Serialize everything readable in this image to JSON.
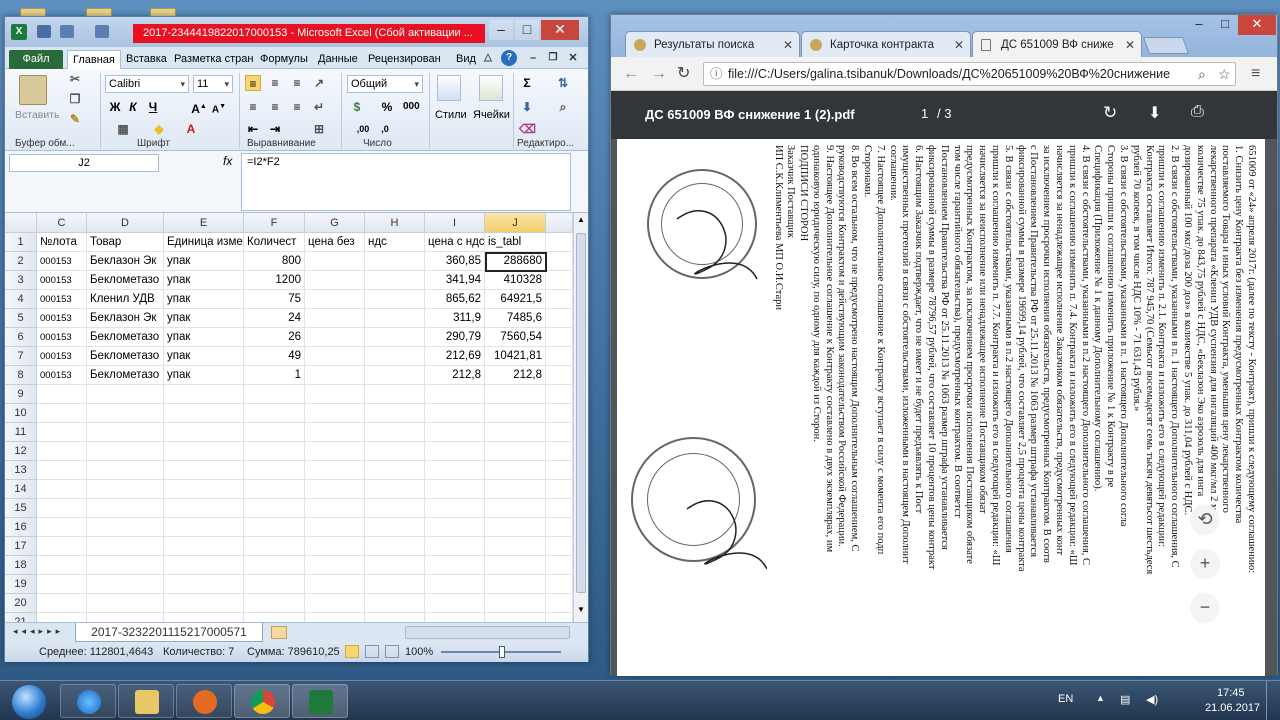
{
  "excel": {
    "title": "2017-2344419822017000153  -  Microsoft Excel (Сбой активации ...",
    "ribbon_tabs": [
      "Файл",
      "Главная",
      "Вставка",
      "Разметка стран",
      "Формулы",
      "Данные",
      "Рецензирован",
      "Вид"
    ],
    "ribbon": {
      "paste": "Вставить",
      "clipboard": "Буфер обм...",
      "font_name": "Calibri",
      "font_size": "11",
      "font_group": "Шрифт",
      "align_group": "Выравнивание",
      "number_format": "Общий",
      "number_group": "Число",
      "styles": "Стили",
      "cells": "Ячейки",
      "editing": "Редактиро..."
    },
    "name_box": "J2",
    "fx": "fx",
    "formula": "=I2*F2",
    "columns": [
      "C",
      "D",
      "E",
      "F",
      "G",
      "H",
      "I",
      "J"
    ],
    "header_row": [
      "№лота",
      "Товар",
      "Единица изме",
      "Количест",
      "цена без",
      "ндс",
      "цена с ндс",
      "is_tabl"
    ],
    "rows": [
      [
        "000153",
        "Беклазон Эк",
        "упак",
        "800",
        "",
        "",
        "360,85",
        "288680"
      ],
      [
        "000153",
        "Беклометазо",
        "упак",
        "1200",
        "",
        "",
        "341,94",
        "410328"
      ],
      [
        "000153",
        "Кленил УДВ",
        "упак",
        "75",
        "",
        "",
        "865,62",
        "64921,5"
      ],
      [
        "000153",
        "Беклазон Эк",
        "упак",
        "24",
        "",
        "",
        "311,9",
        "7485,6"
      ],
      [
        "000153",
        "Беклометазо",
        "упак",
        "26",
        "",
        "",
        "290,79",
        "7560,54"
      ],
      [
        "000153",
        "Беклометазо",
        "упак",
        "49",
        "",
        "",
        "212,69",
        "10421,81"
      ],
      [
        "000153",
        "Беклометазо",
        "упак",
        "1",
        "",
        "",
        "212,8",
        "212,8"
      ]
    ],
    "row_numbers": [
      "1",
      "2",
      "3",
      "4",
      "5",
      "6",
      "7",
      "8",
      "9",
      "10",
      "11",
      "12",
      "13",
      "14",
      "15",
      "16",
      "17",
      "18",
      "19",
      "20",
      "21"
    ],
    "sheet_tab": "2017-3232201115217000571",
    "status": {
      "avg": "Среднее: 112801,4643",
      "count": "Количество: 7",
      "sum": "Сумма: 789610,25",
      "zoom": "100%"
    }
  },
  "chrome": {
    "tabs": [
      "Результаты поиска",
      "Карточка контракта",
      "ДС 651009 ВФ сниже"
    ],
    "url": "file:///C:/Users/galina.tsibanuk/Downloads/ДС%20651009%20ВФ%20снижение",
    "pdf_title": "ДС 651009 ВФ снижение 1 (2).pdf",
    "page_current": "1",
    "page_total": "/ 3",
    "pdf_lines": [
      "651009 от «24» апреля 2017г. (далее по тексту - Контракт), пришли к следующему соглашению:",
      "1. Снизить цену Контракта без изменения предусмотренных Контрактом количества",
      "поставляемого Товара и иных условий Контракта, уменьшив цену лекарственного",
      "лекарственного препарата «Кленил УДВ суспензия для ингаляций 400 мкг/мл 2 мл №",
      "количестве 75 упак. до 843,75 рублей с НДС, «Беклазон Эко аэрозоль для инга",
      "дозированный 100 мкг/доза 200 доз» в количестве 5 упак. до 311,04 рублей с НДС.",
      "2. В связи с обстоятельствами, указанными в п. 1 настоящего Дополнительного соглашения, С",
      "пришли к соглашению изменить п. 2.1. Контракта и изложить его в следующей редакции:",
      "Контракта составляет Итого: 787 945,70 (Семьсот восемьдесят семь тысяч девятьсот шестьдеся",
      "рублей 70 копеек, в том числе НДС 10% - 71 631,43 рубля.»",
      "3. В связи с обстоятельствами, указанными в п. 1 настоящего Дополнительного согла",
      "Стороны пришли к соглашению изменить приложение № 1 к Контракту в ре",
      "Спецификация (Приложение № 1 к данному Дополнительному соглашению).",
      "4. В связи с обстоятельствами, указанными в п.2 настоящего Дополнительного соглашения, С",
      "пришли к соглашению изменить п. 7.4. Контракта и изложить его в следующей редакции: «Ш",
      "начисляется за ненадлежащее исполнение Заказчиком обязательств, предусмотренных конт",
      "за исключением просрочки исполнения обязательств, предусмотренных Контрактом. В соотв",
      "с Постановлением Правительства РФ от 25.11.2013 № 1063 размер штрафа устанавливается",
      "фиксированной суммы в размере 19699,14 рублей, что составляет 2,5 процента цены контракта",
      "5. В связи с обстоятельствами, указанными в п.2 настоящего Дополнительного соглашения",
      "пришли к соглашению изменить п. 7.7. Контракта и изложить его в следующей редакции: «Ш",
      "начисляется за неисполнение или ненадлежащее исполнение Поставщиком обязат",
      "предусмотренных Контрактом, за исключением просрочки исполнения Поставщиком обязате",
      "том числе гарантийного обязательства), предусмотренных контрактом. В соответст",
      "Постановлением Правительства РФ от 25.11.2013 № 1063 размер штрафа устанавливается",
      "фиксированной суммы в размере 78796,57 рублей, что составляет 10 процентов цены контракт",
      "6. Настоящим Заказчик подтверждает, что не имеет и не будет предъявлять к Пост",
      "имущественных претензий в связи с обстоятельствами, изложенными в настоящем Дополнит",
      "соглашении.",
      "7. Настоящее Дополнительное соглашение к Контракту вступает в силу с момента его подп",
      "Сторонами.",
      "8. Во всем остальном, что не предусмотрено настоящим Дополнительным соглашением, С",
      "руководствуются Контрактом и действующим законодательством Российской Федерации.",
      "9. Настоящее Дополнительное соглашение к Контракту составлено в двух экземплярах, им",
      "одинаковую юридическую силу, по одному для каждой из Сторон.",
      "",
      "                              ПОДПИСИ СТОРОН",
      "Заказчик                                                   Поставщик",
      "ИП                  С.К.Климентьева                     МП                       О.И.Стари"
    ]
  },
  "taskbar": {
    "lang": "EN",
    "time": "17:45",
    "date": "21.06.2017"
  },
  "colors": {
    "excel_title_red": "#e81123",
    "excel_green": "#2a6a3a",
    "pdf_toolbar": "#323639",
    "pdf_bg": "#525659"
  }
}
